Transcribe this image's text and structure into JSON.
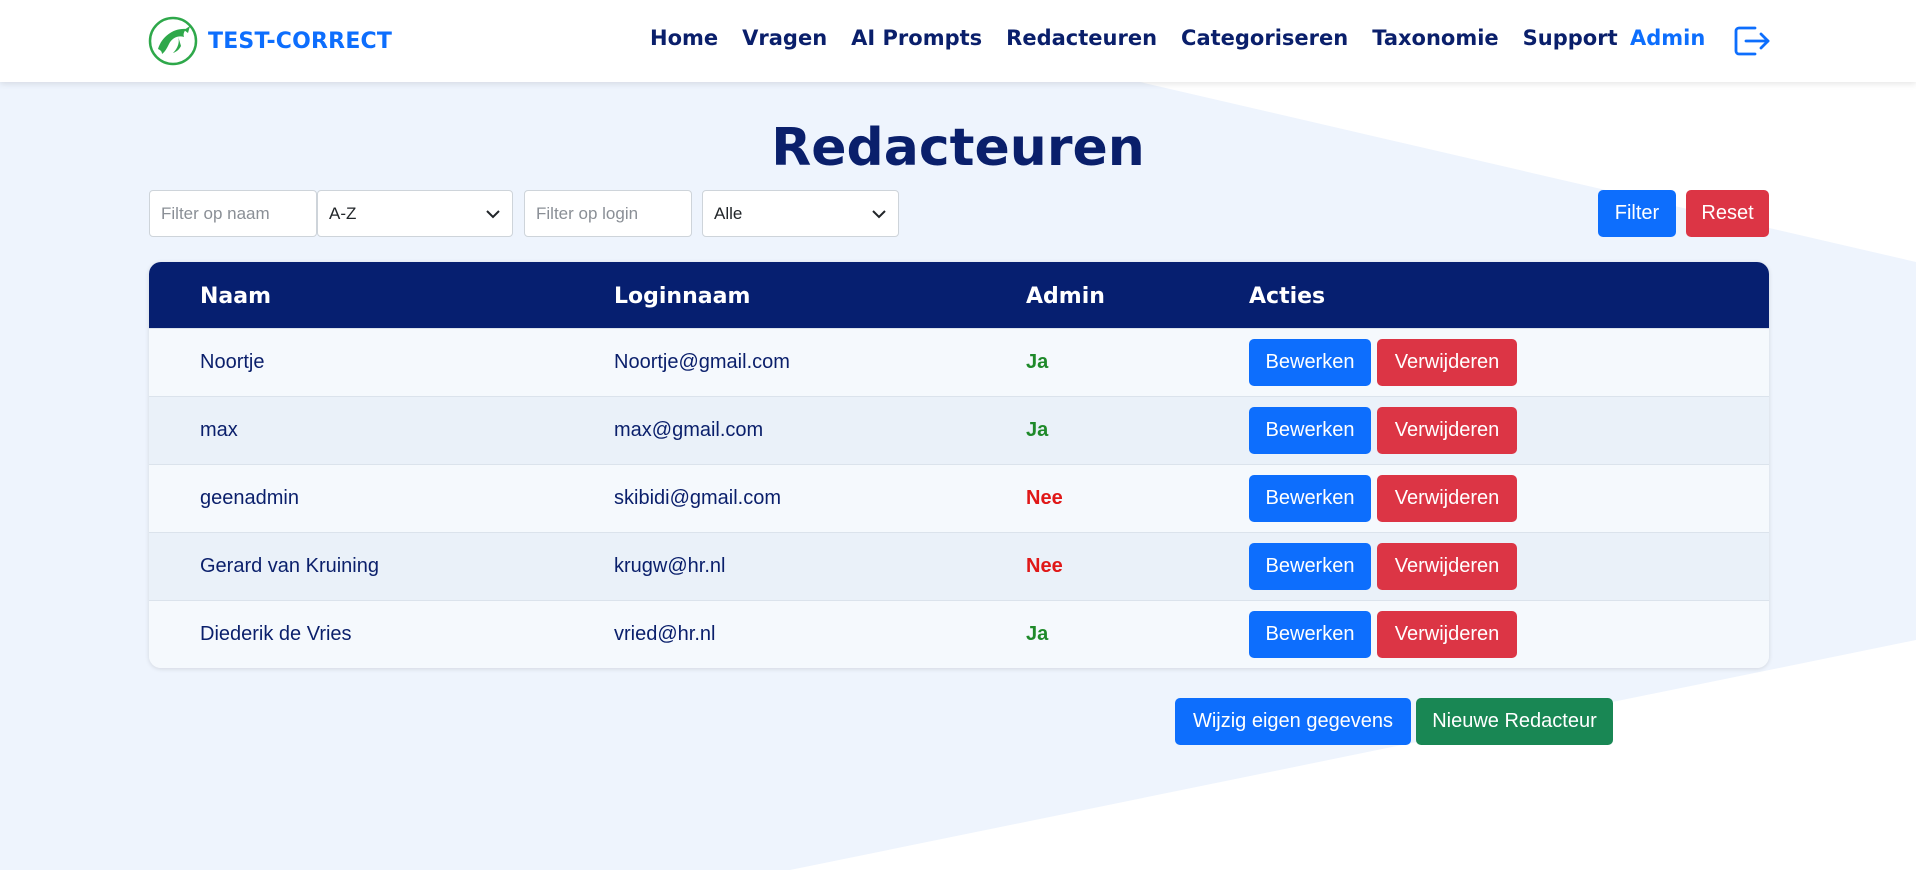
{
  "brand": {
    "name": "TEST-CORRECT",
    "accent": "#0d6efd",
    "logo_green": "#2ea84a"
  },
  "nav": {
    "links": [
      "Home",
      "Vragen",
      "AI Prompts",
      "Redacteuren",
      "Categoriseren",
      "Taxonomie",
      "Support"
    ],
    "admin_label": "Admin",
    "logout_icon": "logout-icon"
  },
  "page": {
    "title": "Redacteuren"
  },
  "filters": {
    "name_placeholder": "Filter op naam",
    "sort_value": "A-Z",
    "login_placeholder": "Filter op login",
    "admin_value": "Alle",
    "filter_label": "Filter",
    "reset_label": "Reset"
  },
  "table": {
    "headers": [
      "Naam",
      "Loginnaam",
      "Admin",
      "Acties"
    ],
    "rows": [
      {
        "name": "Noortje",
        "login": "Noortje@gmail.com",
        "admin": "Ja"
      },
      {
        "name": "max",
        "login": "max@gmail.com",
        "admin": "Ja"
      },
      {
        "name": "geenadmin",
        "login": "skibidi@gmail.com",
        "admin": "Nee"
      },
      {
        "name": "Gerard van Kruining",
        "login": "krugw@hr.nl",
        "admin": "Nee"
      },
      {
        "name": "Diederik de Vries",
        "login": "vried@hr.nl",
        "admin": "Ja"
      }
    ],
    "edit_label": "Bewerken",
    "delete_label": "Verwijderen"
  },
  "footer_actions": {
    "edit_own_label": "Wijzig eigen gegevens",
    "new_label": "Nieuwe Redacteur"
  },
  "colors": {
    "navy": "#061f70",
    "primary": "#0d6efd",
    "danger": "#dc3545",
    "success": "#198754",
    "yes": "#1f8a2a",
    "no": "#e01818"
  }
}
